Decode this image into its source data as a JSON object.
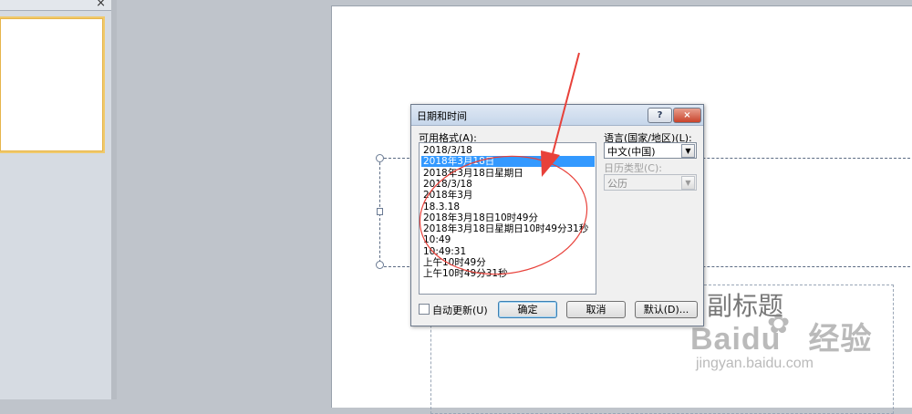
{
  "left_panel": {
    "close_glyph": "×"
  },
  "slide": {
    "subtitle_placeholder": "副标题"
  },
  "watermark": {
    "brand": "Baidu",
    "suffix": "经验",
    "url": "jingyan.baidu.com"
  },
  "dialog": {
    "title": "日期和时间",
    "help_label": "?",
    "close_label": "×",
    "formats_label": "可用格式(A):",
    "formats": [
      "2018/3/18",
      "2018年3月18日",
      "2018年3月18日星期日",
      "2018/3/18",
      "2018年3月",
      "18.3.18",
      "2018年3月18日10时49分",
      "2018年3月18日星期日10时49分31秒",
      "10:49",
      "10:49:31",
      "上午10时49分",
      "上午10时49分31秒"
    ],
    "selected_index": 1,
    "language_label": "语言(国家/地区)(L):",
    "language_value": "中文(中国)",
    "calendar_label": "日历类型(C):",
    "calendar_value": "公历",
    "auto_update_label": "自动更新(U)",
    "auto_update_checked": false,
    "ok_label": "确定",
    "cancel_label": "取消",
    "default_label": "默认(D)..."
  },
  "colors": {
    "selection": "#3399ff",
    "annotation": "#e8413a"
  }
}
